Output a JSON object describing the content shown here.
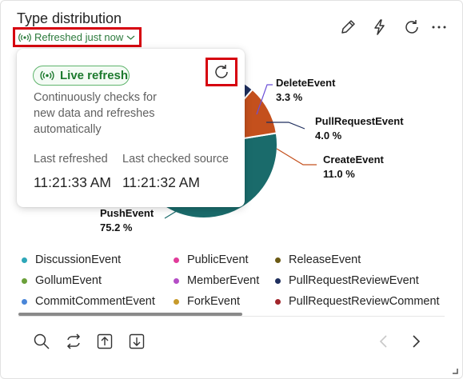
{
  "card": {
    "title": "Type distribution",
    "refresh_status": "Refreshed just now"
  },
  "toolbar": {
    "icons": [
      "edit-icon",
      "lightning-icon",
      "refresh-icon",
      "more-icon"
    ]
  },
  "popover": {
    "live_label": "Live refresh",
    "description": "Continuously checks for new data and refreshes automatically",
    "last_refreshed_label": "Last refreshed",
    "last_refreshed_value": "11:21:33 AM",
    "last_checked_label": "Last checked source",
    "last_checked_value": "11:21:32 AM"
  },
  "chart_data": {
    "type": "pie",
    "series": [
      {
        "name": "PushEvent",
        "label": "PushEvent",
        "value_label": "75.2 %",
        "value": 75.2,
        "color": "#1a6b6b"
      },
      {
        "name": "CreateEvent",
        "label": "CreateEvent",
        "value_label": "11.0 %",
        "value": 11.0,
        "color": "#c4501d"
      },
      {
        "name": "PullRequestEvent",
        "label": "PullRequestEvent",
        "value_label": "4.0 %",
        "value": 4.0,
        "color": "#1f2f5e"
      },
      {
        "name": "DeleteEvent",
        "label": "DeleteEvent",
        "value_label": "3.3 %",
        "value": 3.3,
        "color": "#6b4fd8"
      }
    ]
  },
  "legend": [
    {
      "label": "DiscussionEvent",
      "color": "#2ea7b8"
    },
    {
      "label": "PublicEvent",
      "color": "#e13c9a"
    },
    {
      "label": "ReleaseEvent",
      "color": "#6b5a14"
    },
    {
      "label": "GollumEvent",
      "color": "#6ba03a"
    },
    {
      "label": "MemberEvent",
      "color": "#b44ec6"
    },
    {
      "label": "PullRequestReviewEvent",
      "color": "#1f2f5e"
    },
    {
      "label": "CommitCommentEvent",
      "color": "#4a86d8"
    },
    {
      "label": "ForkEvent",
      "color": "#c79a2b"
    },
    {
      "label": "PullRequestReviewComment",
      "color": "#a1252b"
    }
  ],
  "bottom_toolbar": {
    "icons": [
      "search-icon",
      "swap-icon",
      "upload-icon",
      "download-icon",
      "prev-icon",
      "next-icon"
    ]
  }
}
